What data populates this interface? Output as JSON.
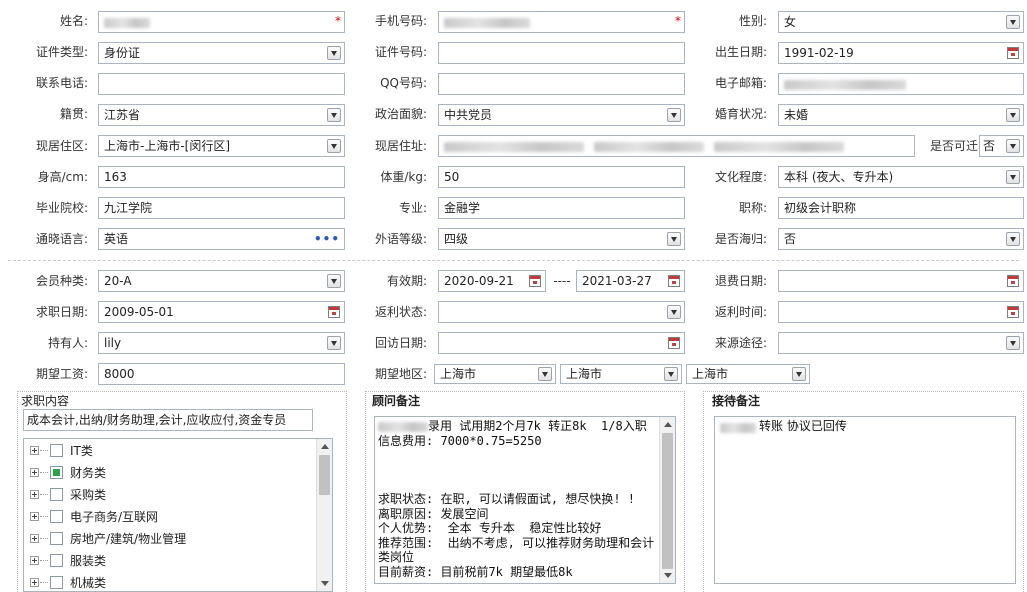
{
  "colors": {
    "border": "#a9b4c2",
    "checked": "#2fa24a",
    "panel_border": "#b8b8b8",
    "required": "#dd0000"
  },
  "consultant_notes": {
    "lines": [
      "录用 试用期2个月7k 转正8k  1/8入职",
      "信息费用: 7000*0.75=5250",
      "",
      "",
      "",
      "求职状态: 在职, 可以请假面试, 想尽快换! !",
      "离职原因: 发展空间",
      "个人优势:  全本 专升本  稳定性比较好",
      "推荐范围:  出纳不考虑, 可以推荐财务助理和会计",
      "类岗位",
      "目前薪资: 目前税前7k 期望最低8k"
    ],
    "title": "顾问备注"
  },
  "job_content": {
    "summary": "成本会计,出纳/财务助理,会计,应收应付,资金专员",
    "title": "求职内容",
    "tree": [
      {
        "checked": false,
        "label": "IT类"
      },
      {
        "checked": true,
        "label": "财务类"
      },
      {
        "checked": false,
        "label": "采购类"
      },
      {
        "checked": false,
        "label": "电子商务/互联网"
      },
      {
        "checked": false,
        "label": "房地产/建筑/物业管理"
      },
      {
        "checked": false,
        "label": "服装类"
      },
      {
        "checked": false,
        "label": "机械类"
      }
    ]
  },
  "personal": {
    "birth_date": {
      "label": "出生日期:",
      "value": "1991-02-19"
    },
    "current_address": {
      "label": "现居住址:",
      "value": ""
    },
    "current_area": {
      "label": "现居住区:",
      "value": "上海市-上海市-[闵行区]"
    },
    "education": {
      "label": "文化程度:",
      "value": "本科 (夜大、专升本)"
    },
    "email": {
      "label": "电子邮箱:",
      "value": ""
    },
    "foreign_level": {
      "label": "外语等级:",
      "value": "四级"
    },
    "gender": {
      "label": "性别:",
      "value": "女"
    },
    "graduated_school": {
      "label": "毕业院校:",
      "value": "九江学院"
    },
    "height": {
      "label": "身高/cm:",
      "value": "163"
    },
    "id_number": {
      "label": "证件号码:",
      "value": ""
    },
    "id_type": {
      "label": "证件类型:",
      "value": "身份证"
    },
    "languages": {
      "label": "通晓语言:",
      "value": "英语"
    },
    "major": {
      "label": "专业:",
      "value": "金融学"
    },
    "marital": {
      "label": "婚育状况:",
      "value": "未婚"
    },
    "mobile": {
      "label": "手机号码:",
      "value": ""
    },
    "name": {
      "label": "姓名:",
      "value": ""
    },
    "native_place": {
      "label": "籍贯:",
      "value": "江苏省"
    },
    "overseas": {
      "label": "是否海归:",
      "value": "否"
    },
    "phone": {
      "label": "联系电话:",
      "value": ""
    },
    "political": {
      "label": "政治面貌:",
      "value": "中共党员"
    },
    "qq": {
      "label": "QQ号码:",
      "value": ""
    },
    "relocate": {
      "label": "是否可迁",
      "value": "否"
    },
    "title_cert": {
      "label": "职称:",
      "value": "初级会计职称"
    },
    "weight": {
      "label": "体重/kg:",
      "value": "50"
    }
  },
  "membership": {
    "expected_area": {
      "label": "期望地区:",
      "value1": "上海市",
      "value2": "上海市",
      "value3": "上海市"
    },
    "expected_salary": {
      "label": "期望工资:",
      "value": "8000"
    },
    "holder": {
      "label": "持有人:",
      "value": "lily"
    },
    "job_seek_date": {
      "label": "求职日期:",
      "value": "2009-05-01"
    },
    "member_type": {
      "label": "会员种类:",
      "value": "20-A"
    },
    "rebate_status": {
      "label": "返利状态:",
      "value": ""
    },
    "rebate_time": {
      "label": "返利时间:",
      "value": ""
    },
    "refund_date": {
      "label": "退费日期:",
      "value": ""
    },
    "source": {
      "label": "来源途径:",
      "value": ""
    },
    "valid_period": {
      "from": "2020-09-21",
      "label": "有效期:",
      "sep": "----",
      "to": "2021-03-27"
    },
    "visit_date": {
      "label": "回访日期:",
      "value": ""
    }
  },
  "reception_notes": {
    "text": "转账 协议已回传",
    "title": "接待备注"
  }
}
